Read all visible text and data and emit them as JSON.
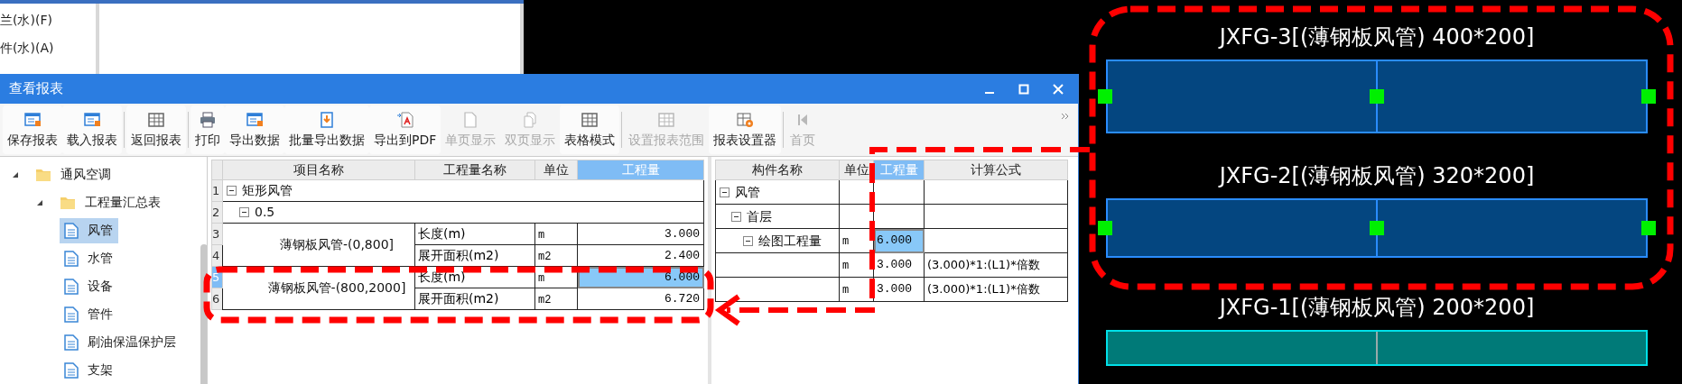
{
  "background_panel": {
    "items": [
      "兰(水)(F)",
      "件(水)(A)"
    ]
  },
  "window": {
    "title": "查看报表"
  },
  "toolbar": [
    {
      "label": "保存报表",
      "disabled": false,
      "separator_before": false
    },
    {
      "label": "载入报表",
      "disabled": false,
      "separator_before": false
    },
    {
      "label": "返回报表",
      "disabled": false,
      "separator_before": true
    },
    {
      "label": "打印",
      "disabled": false,
      "separator_before": true
    },
    {
      "label": "导出数据",
      "disabled": false,
      "separator_before": false
    },
    {
      "label": "批量导出数据",
      "disabled": false,
      "separator_before": false
    },
    {
      "label": "导出到PDF",
      "disabled": false,
      "separator_before": false
    },
    {
      "label": "单页显示",
      "disabled": true,
      "separator_before": false
    },
    {
      "label": "双页显示",
      "disabled": true,
      "separator_before": false
    },
    {
      "label": "表格模式",
      "disabled": false,
      "separator_before": false
    },
    {
      "label": "设置报表范围",
      "disabled": true,
      "separator_before": true
    },
    {
      "label": "报表设置器",
      "disabled": false,
      "separator_before": false
    },
    {
      "label": "首页",
      "disabled": true,
      "separator_before": true
    }
  ],
  "report_tree": [
    {
      "label": "通风空调",
      "kind": "folder",
      "expanded": true,
      "selected": false,
      "children": [
        {
          "label": "工程量汇总表",
          "kind": "folder",
          "expanded": true,
          "selected": false,
          "children": [
            {
              "label": "风管",
              "kind": "report",
              "selected": true
            },
            {
              "label": "水管",
              "kind": "report",
              "selected": false
            },
            {
              "label": "设备",
              "kind": "report",
              "selected": false
            },
            {
              "label": "管件",
              "kind": "report",
              "selected": false
            },
            {
              "label": "刷油保温保护层",
              "kind": "report",
              "selected": false
            },
            {
              "label": "支架",
              "kind": "report",
              "selected": false
            }
          ]
        }
      ]
    }
  ],
  "quantity_table": {
    "columns": [
      {
        "label": "项目名称",
        "selected": false
      },
      {
        "label": "工程量名称",
        "selected": false
      },
      {
        "label": "单位",
        "selected": false
      },
      {
        "label": "工程量",
        "selected": true
      }
    ],
    "row_numbers": [
      {
        "label": "1",
        "selected": false
      },
      {
        "label": "2",
        "selected": false
      },
      {
        "label": "3",
        "selected": false
      },
      {
        "label": "4",
        "selected": false
      },
      {
        "label": "5",
        "selected": true
      },
      {
        "label": "6",
        "selected": false
      }
    ],
    "tree": [
      {
        "label": "矩形风管",
        "expanded": true,
        "children": [
          {
            "label": "0.5",
            "expanded": true,
            "children": [
              {
                "label": "薄钢板风管-(0,800]",
                "quantities": [
                  {
                    "name": "长度(m)",
                    "unit": "m",
                    "value": "3.000",
                    "selected": false
                  },
                  {
                    "name": "展开面积(m2)",
                    "unit": "m2",
                    "value": "2.400",
                    "selected": false
                  }
                ]
              },
              {
                "label": "薄钢板风管-(800,2000]",
                "quantities": [
                  {
                    "name": "长度(m)",
                    "unit": "m",
                    "value": "6.000",
                    "selected": true
                  },
                  {
                    "name": "展开面积(m2)",
                    "unit": "m2",
                    "value": "6.720",
                    "selected": false
                  }
                ]
              }
            ]
          }
        ]
      }
    ]
  },
  "component_table": {
    "columns": [
      {
        "label": "构件名称",
        "selected": false
      },
      {
        "label": "单位",
        "selected": false
      },
      {
        "label": "工程量",
        "selected": true
      },
      {
        "label": "计算公式",
        "selected": false
      }
    ],
    "tree": [
      {
        "label": "风管",
        "expanded": true,
        "children": [
          {
            "label": "首层",
            "expanded": true,
            "children": [
              {
                "label": "绘图工程量",
                "expanded": true,
                "unit": "m",
                "value": "6.000",
                "selected": true,
                "children": [
                  {
                    "unit": "m",
                    "value": "3.000",
                    "formula": "(3.000)*1:(L1)*倍数",
                    "selected": false
                  },
                  {
                    "unit": "m",
                    "value": "3.000",
                    "formula": "(3.000)*1:(L1)*倍数",
                    "selected": false
                  }
                ]
              }
            ]
          }
        ]
      }
    ]
  },
  "drawing_canvas": {
    "ducts": [
      {
        "label": "JXFG-3[(薄钢板风管) 400*200]",
        "selected": true
      },
      {
        "label": "JXFG-2[(薄钢板风管) 320*200]",
        "selected": true
      },
      {
        "label": "JXFG-1[(薄钢板风管) 200*200]",
        "selected": false
      }
    ]
  }
}
